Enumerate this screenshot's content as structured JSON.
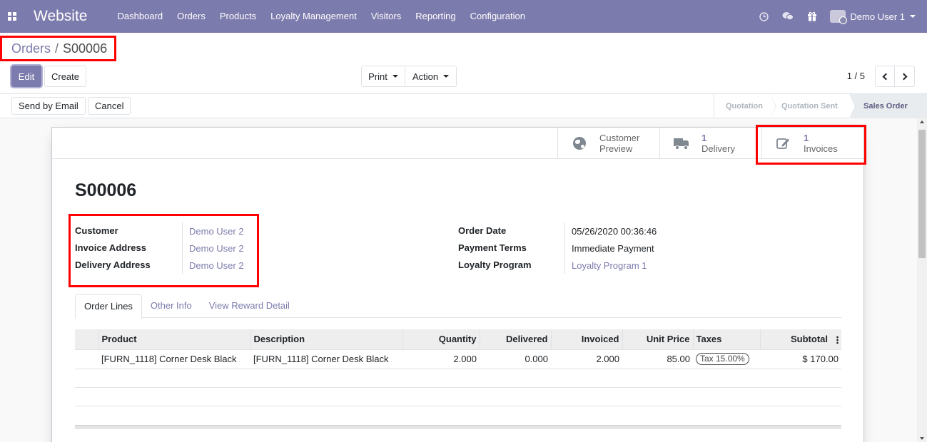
{
  "navbar": {
    "brand": "Website",
    "menu": [
      "Dashboard",
      "Orders",
      "Products",
      "Loyalty Management",
      "Visitors",
      "Reporting",
      "Configuration"
    ],
    "icons": [
      "clock-icon",
      "chat-icon",
      "gift-icon"
    ],
    "user": "Demo User 1"
  },
  "breadcrumb": {
    "parent": "Orders",
    "separator": "/",
    "current": "S00006"
  },
  "actions": {
    "edit": "Edit",
    "create": "Create",
    "print": "Print",
    "action": "Action"
  },
  "pager": {
    "value": "1 / 5"
  },
  "statusbar": {
    "send_email": "Send by Email",
    "cancel": "Cancel",
    "stages": [
      "Quotation",
      "Quotation Sent",
      "Sales Order"
    ],
    "active_stage": "Sales Order"
  },
  "smart_buttons": {
    "preview": {
      "line1": "Customer",
      "line2": "Preview"
    },
    "delivery": {
      "count": "1",
      "label": "Delivery"
    },
    "invoices": {
      "count": "1",
      "label": "Invoices"
    }
  },
  "record": {
    "name": "S00006",
    "left_fields": [
      {
        "label": "Customer",
        "value": "Demo User 2"
      },
      {
        "label": "Invoice Address",
        "value": "Demo User 2"
      },
      {
        "label": "Delivery Address",
        "value": "Demo User 2"
      }
    ],
    "right_fields": [
      {
        "label": "Order Date",
        "value": "05/26/2020 00:36:46"
      },
      {
        "label": "Payment Terms",
        "value": "Immediate Payment"
      },
      {
        "label": "Loyalty Program",
        "value": "Loyalty Program 1"
      }
    ]
  },
  "tabs": [
    "Order Lines",
    "Other Info",
    "View Reward Detail"
  ],
  "order_lines": {
    "headers": [
      "Product",
      "Description",
      "Quantity",
      "Delivered",
      "Invoiced",
      "Unit Price",
      "Taxes",
      "Subtotal"
    ],
    "rows": [
      {
        "product": "[FURN_1118] Corner Desk Black",
        "description": "[FURN_1118] Corner Desk Black",
        "quantity": "2.000",
        "delivered": "0.000",
        "invoiced": "2.000",
        "unit_price": "85.00",
        "taxes": "Tax 15.00%",
        "subtotal": "$ 170.00"
      }
    ]
  },
  "colors": {
    "brand": "#7c7bad",
    "highlight": "#ff0000"
  }
}
